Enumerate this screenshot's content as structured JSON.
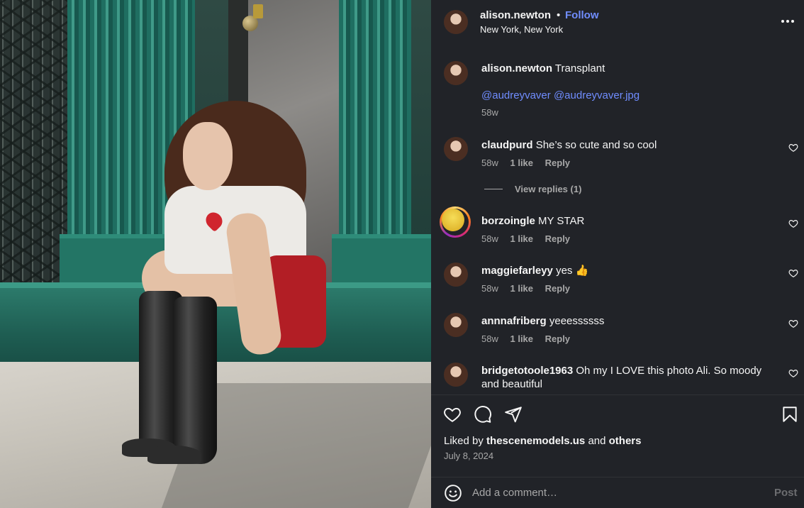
{
  "post": {
    "username": "alison.newton",
    "dot": "•",
    "follow_label": "Follow",
    "location": "New York, New York"
  },
  "caption": {
    "username": "alison.newton",
    "text": "Transplant",
    "mentions": [
      "@audreyvaver",
      "@audreyvaver.jpg"
    ],
    "time": "58w"
  },
  "comments": [
    {
      "username": "claudpurd",
      "text": "She’s so cute and so cool",
      "time": "58w",
      "likes": "1 like",
      "reply": "Reply"
    },
    {
      "username": "borzoingle",
      "text": "MY STAR",
      "time": "58w",
      "likes": "1 like",
      "reply": "Reply"
    },
    {
      "username": "maggiefarleyy",
      "text": "yes 👍",
      "time": "58w",
      "likes": "1 like",
      "reply": "Reply"
    },
    {
      "username": "annnafriberg",
      "text": "yeeessssss",
      "time": "58w",
      "likes": "1 like",
      "reply": "Reply"
    },
    {
      "username": "bridgetotoole1963",
      "text": "Oh my I LOVE this photo Ali. So moody and beautiful"
    }
  ],
  "view_replies": "View replies (1)",
  "engagement": {
    "liked_by_prefix": "Liked by",
    "liked_by_user": "thescenemodels.us",
    "and": "and",
    "others": "others",
    "date": "July 8, 2024"
  },
  "add_comment": {
    "placeholder": "Add a comment…",
    "post_label": "Post"
  },
  "colors": {
    "panel_bg": "#212328",
    "link_blue": "#708dff",
    "muted": "#a8a8a8",
    "text": "#f5f5f5"
  },
  "icons": [
    "more-options-icon",
    "heart-icon",
    "comment-icon",
    "share-icon",
    "bookmark-icon",
    "emoji-icon"
  ]
}
